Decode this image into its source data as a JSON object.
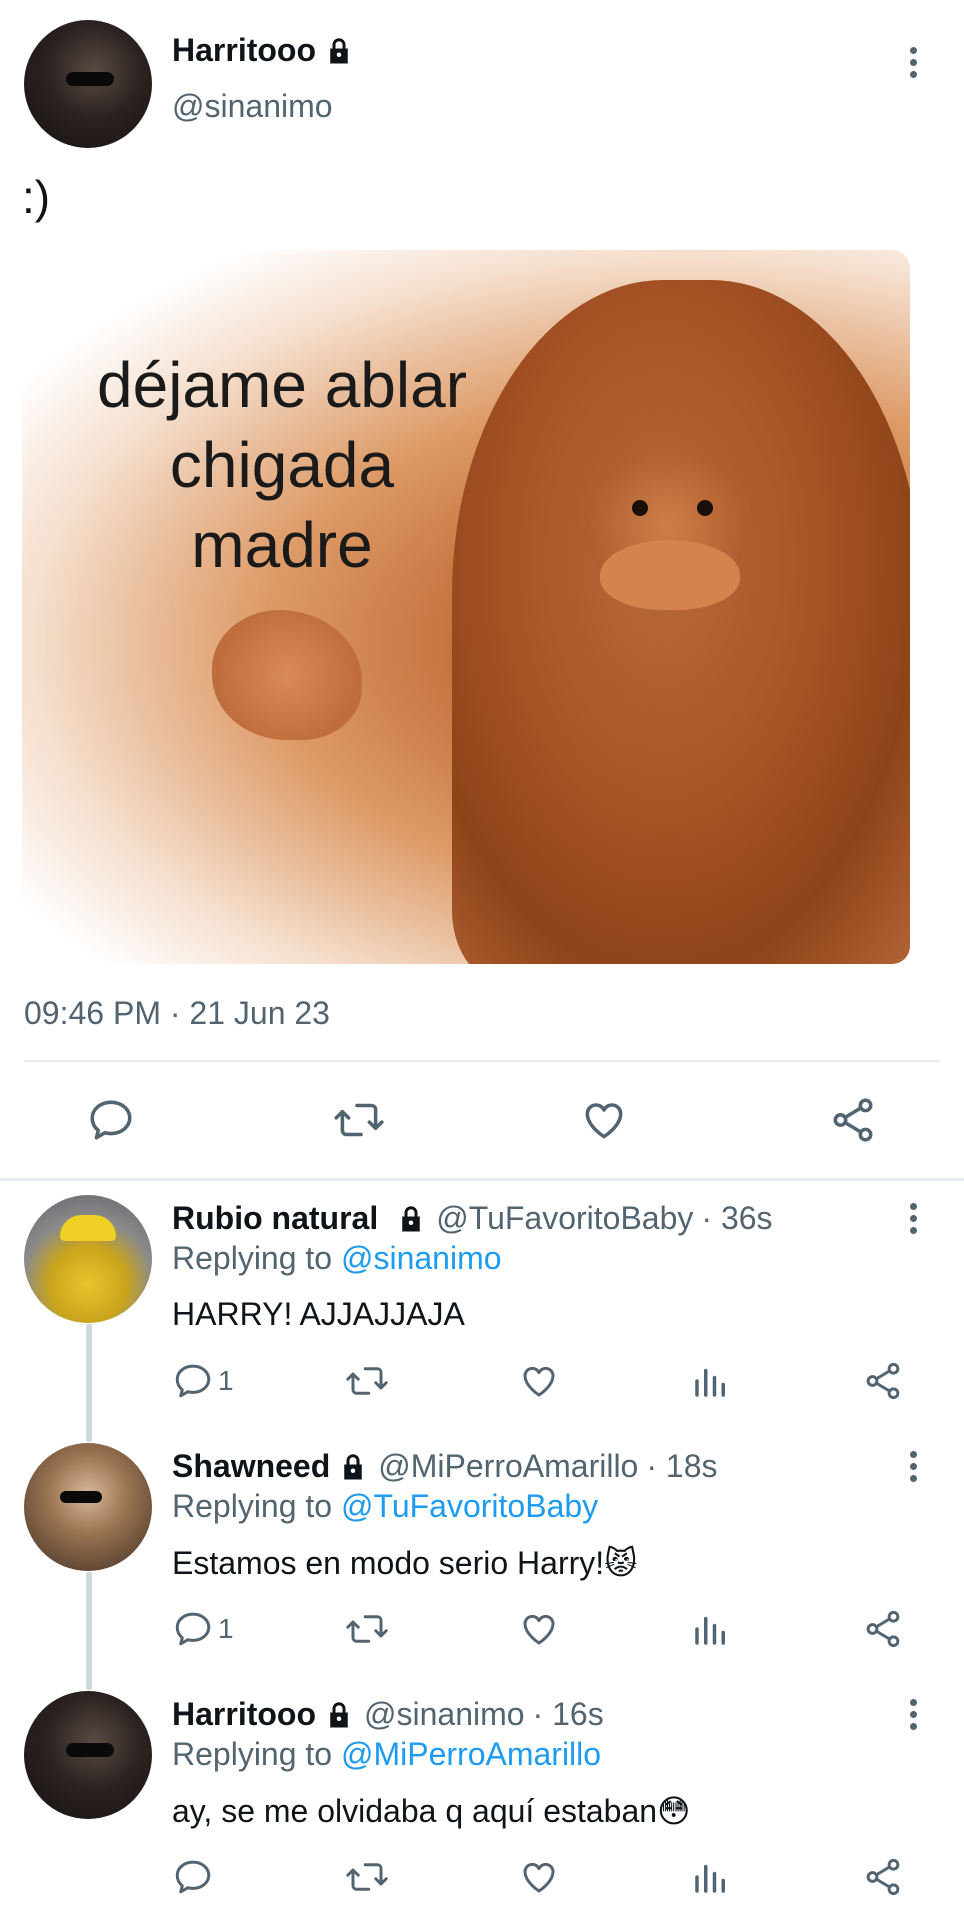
{
  "main_tweet": {
    "display_name": "Harritooo",
    "handle": "@sinanimo",
    "text": ":)",
    "image_text": [
      "déjame ablar",
      "chigada",
      "madre"
    ],
    "timestamp": "09:46 PM · 21 Jun 23"
  },
  "replies": [
    {
      "display_name": "Rubio natural",
      "handle": "@TuFavoritoBaby",
      "age": "· 36s",
      "replying_label": "Replying to",
      "replying_to": "@sinanimo",
      "text": "HARRY! AJJAJJAJA",
      "reply_count": "1"
    },
    {
      "display_name": "Shawneed",
      "handle": "@MiPerroAmarillo",
      "age": "· 18s",
      "replying_label": "Replying to",
      "replying_to": "@TuFavoritoBaby",
      "text": "Estamos en modo serio Harry!😾",
      "reply_count": "1"
    },
    {
      "display_name": "Harritooo",
      "handle": "@sinanimo",
      "age": "· 16s",
      "replying_label": "Replying to",
      "replying_to": "@MiPerroAmarillo",
      "text": "ay, se me olvidaba q aquí estaban😳",
      "reply_count": ""
    }
  ],
  "icons": {
    "reply": "reply-icon",
    "retweet": "retweet-icon",
    "like": "heart-icon",
    "views": "views-icon",
    "share": "share-icon",
    "lock": "lock-icon",
    "more": "more-icon"
  },
  "colors": {
    "text_primary": "#0f1419",
    "text_secondary": "#536471",
    "mention": "#1d9bf0",
    "divider": "#e6ecf0"
  }
}
